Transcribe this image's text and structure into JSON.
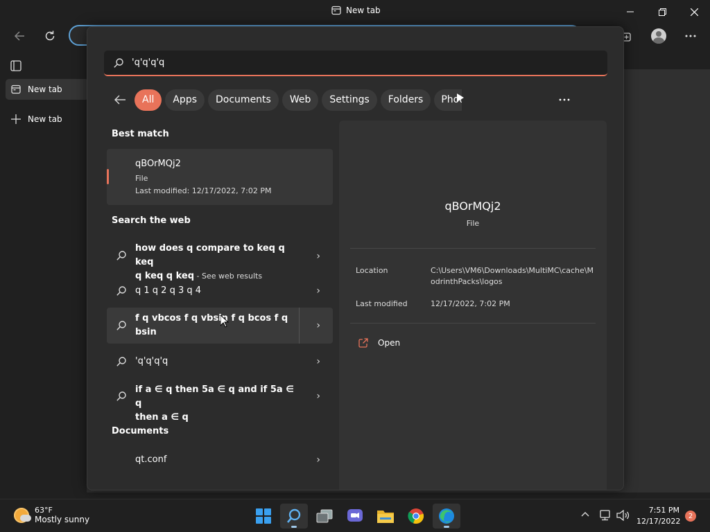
{
  "browser": {
    "tab_title": "New tab",
    "sidebar_tabs": [
      {
        "label": "New tab"
      },
      {
        "label": "New tab"
      }
    ]
  },
  "search": {
    "query": "'q'q'q'q",
    "filters": [
      "All",
      "Apps",
      "Documents",
      "Web",
      "Settings",
      "Folders",
      "Photos"
    ],
    "active_filter": "All",
    "best_match": {
      "section_title": "Best match",
      "name": "qBOrMQj2",
      "type": "File",
      "modified": "Last modified: 12/17/2022, 7:02 PM"
    },
    "web": {
      "section_title": "Search the web",
      "items": [
        {
          "line1": "how does q compare to keq q keq",
          "line2": "q keq q keq",
          "suffix": " - See web results"
        },
        {
          "line1": "q 1 q 2 q 3 q 4",
          "line2": "",
          "suffix": ""
        },
        {
          "line1": "f q vbcos f q vbsin f q bcos f q",
          "line2": "bsin",
          "suffix": ""
        },
        {
          "line1": "'q'q'q'q",
          "line2": "",
          "suffix": ""
        },
        {
          "line1": "if a ∈ q then 5a ∈ q and if 5a ∈ q",
          "line2": "then a ∈ q",
          "suffix": ""
        }
      ]
    },
    "documents": {
      "section_title": "Documents",
      "items": [
        {
          "name": "qt.conf"
        }
      ]
    },
    "detail": {
      "name": "qBOrMQj2",
      "type": "File",
      "location_label": "Location",
      "location_value": "C:\\Users\\VM6\\Downloads\\MultiMC\\cache\\ModrinthPacks\\logos",
      "modified_label": "Last modified",
      "modified_value": "12/17/2022, 7:02 PM",
      "open_label": "Open"
    }
  },
  "taskbar": {
    "weather_temp": "63°F",
    "weather_desc": "Mostly sunny",
    "time": "7:51 PM",
    "date": "12/17/2022",
    "notification_count": "2"
  },
  "colors": {
    "accent": "#e8735a",
    "panel": "#2c2c2c",
    "detail": "#333333"
  }
}
